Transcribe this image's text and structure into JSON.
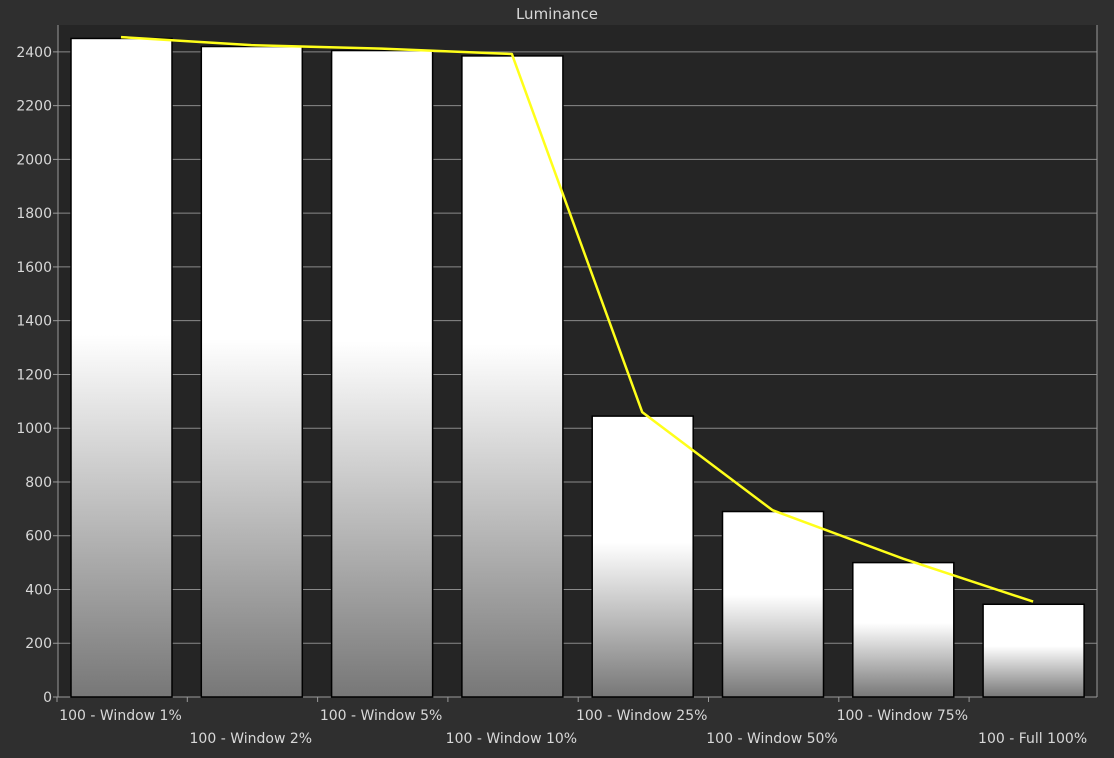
{
  "chart_data": {
    "type": "bar",
    "title": "Luminance",
    "categories": [
      "100 - Window  1%",
      "100 - Window  2%",
      "100 - Window  5%",
      "100 - Window 10%",
      "100 - Window 25%",
      "100 - Window 50%",
      "100 - Window 75%",
      "100 - Full  100%"
    ],
    "series": [
      {
        "type": "bar",
        "values": [
          2450,
          2420,
          2405,
          2385,
          1045,
          690,
          500,
          345
        ]
      },
      {
        "type": "line",
        "values": [
          2455,
          2425,
          2412,
          2392,
          1060,
          695,
          515,
          355
        ]
      }
    ],
    "ylim": [
      0,
      2500
    ],
    "yticks": [
      0,
      200,
      400,
      600,
      800,
      1000,
      1200,
      1400,
      1600,
      1800,
      2000,
      2200,
      2400
    ],
    "grid": true,
    "colors": {
      "background": "#2f2f2f",
      "plot_background": "#252525",
      "grid": "#8a8a8a",
      "axis": "#9a9a9a",
      "text": "#d8d8d8",
      "bar_top": "#ffffff",
      "bar_bottom": "#777777",
      "bar_stroke": "#000000",
      "line": "#ffff1a"
    }
  }
}
